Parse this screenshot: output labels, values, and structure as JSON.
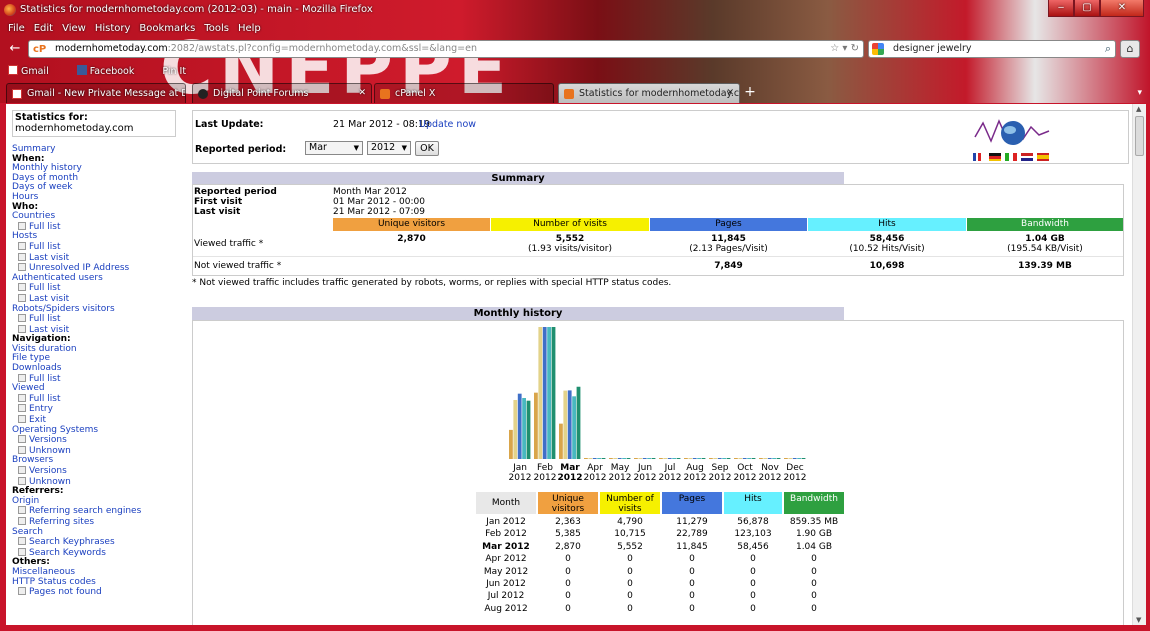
{
  "window": {
    "title": "Statistics for modernhometoday.com (2012-03) - main - Mozilla Firefox",
    "menu": [
      "File",
      "Edit",
      "View",
      "History",
      "Bookmarks",
      "Tools",
      "Help"
    ],
    "url_host": "modernhometoday.com",
    "url_path": ":2082/awstats.pl?config=modernhometoday.com&ssl=&lang=en",
    "url_badge": "cP",
    "search_value": "designer jewelry",
    "bookmarks": [
      "Gmail",
      "Facebook",
      "Pin It"
    ],
    "tabs": [
      {
        "label": "Gmail - New Private Message at Digit..."
      },
      {
        "label": "Digital Point Forums"
      },
      {
        "label": "cPanel X"
      },
      {
        "label": "Statistics for modernhometoday.com..."
      }
    ]
  },
  "sidebar": {
    "stats_for_label": "Statistics for:",
    "domain": "modernhometoday.com",
    "items": [
      {
        "t": "lk",
        "label": "Summary"
      },
      {
        "t": "hd",
        "label": "When:"
      },
      {
        "t": "lk",
        "label": "Monthly history"
      },
      {
        "t": "lk",
        "label": "Days of month"
      },
      {
        "t": "lk",
        "label": "Days of week"
      },
      {
        "t": "lk",
        "label": "Hours"
      },
      {
        "t": "hd",
        "label": "Who:"
      },
      {
        "t": "lk",
        "label": "Countries"
      },
      {
        "t": "sub",
        "label": "Full list"
      },
      {
        "t": "lk",
        "label": "Hosts"
      },
      {
        "t": "sub",
        "label": "Full list"
      },
      {
        "t": "sub",
        "label": "Last visit"
      },
      {
        "t": "sub",
        "label": "Unresolved IP Address"
      },
      {
        "t": "lk",
        "label": "Authenticated users"
      },
      {
        "t": "sub",
        "label": "Full list"
      },
      {
        "t": "sub",
        "label": "Last visit"
      },
      {
        "t": "lk",
        "label": "Robots/Spiders visitors"
      },
      {
        "t": "sub",
        "label": "Full list"
      },
      {
        "t": "sub",
        "label": "Last visit"
      },
      {
        "t": "hd",
        "label": "Navigation:"
      },
      {
        "t": "lk",
        "label": "Visits duration"
      },
      {
        "t": "lk",
        "label": "File type"
      },
      {
        "t": "lk",
        "label": "Downloads"
      },
      {
        "t": "sub",
        "label": "Full list"
      },
      {
        "t": "lk",
        "label": "Viewed"
      },
      {
        "t": "sub",
        "label": "Full list"
      },
      {
        "t": "sub",
        "label": "Entry"
      },
      {
        "t": "sub",
        "label": "Exit"
      },
      {
        "t": "lk",
        "label": "Operating Systems"
      },
      {
        "t": "sub",
        "label": "Versions"
      },
      {
        "t": "sub",
        "label": "Unknown"
      },
      {
        "t": "lk",
        "label": "Browsers"
      },
      {
        "t": "sub",
        "label": "Versions"
      },
      {
        "t": "sub",
        "label": "Unknown"
      },
      {
        "t": "hd",
        "label": "Referrers:"
      },
      {
        "t": "lk",
        "label": "Origin"
      },
      {
        "t": "sub",
        "label": "Referring search engines"
      },
      {
        "t": "sub",
        "label": "Referring sites"
      },
      {
        "t": "lk",
        "label": "Search"
      },
      {
        "t": "sub",
        "label": "Search Keyphrases"
      },
      {
        "t": "sub",
        "label": "Search Keywords"
      },
      {
        "t": "hd",
        "label": "Others:"
      },
      {
        "t": "lk",
        "label": "Miscellaneous"
      },
      {
        "t": "lk",
        "label": "HTTP Status codes"
      },
      {
        "t": "sub",
        "label": "Pages not found"
      }
    ]
  },
  "update": {
    "last_update_label": "Last Update:",
    "last_update_value": "21 Mar 2012 - 08:19",
    "update_now": "Update now",
    "period_label": "Reported period:",
    "month": "Mar",
    "year": "2012",
    "ok": "OK"
  },
  "summary": {
    "title": "Summary",
    "reported_period_label": "Reported period",
    "reported_period_value": "Month Mar 2012",
    "first_visit_label": "First visit",
    "first_visit_value": "01 Mar 2012 - 00:00",
    "last_visit_label": "Last visit",
    "last_visit_value": "21 Mar 2012 - 07:09",
    "headers": [
      "Unique visitors",
      "Number of visits",
      "Pages",
      "Hits",
      "Bandwidth"
    ],
    "viewed_label": "Viewed traffic *",
    "viewed": [
      {
        "v": "2,870",
        "s": ""
      },
      {
        "v": "5,552",
        "s": "(1.93 visits/visitor)"
      },
      {
        "v": "11,845",
        "s": "(2.13 Pages/Visit)"
      },
      {
        "v": "58,456",
        "s": "(10.52 Hits/Visit)"
      },
      {
        "v": "1.04 GB",
        "s": "(195.54 KB/Visit)"
      }
    ],
    "notviewed_label": "Not viewed traffic *",
    "notviewed": [
      "",
      "",
      "7,849",
      "10,698",
      "139.39 MB"
    ],
    "note": "* Not viewed traffic includes traffic generated by robots, worms, or replies with special HTTP status codes."
  },
  "history": {
    "title": "Monthly history",
    "headers": [
      "Month",
      "Unique visitors",
      "Number of visits",
      "Pages",
      "Hits",
      "Bandwidth"
    ],
    "rows": [
      [
        "Jan 2012",
        "2,363",
        "4,790",
        "11,279",
        "56,878",
        "859.35 MB"
      ],
      [
        "Feb 2012",
        "5,385",
        "10,715",
        "22,789",
        "123,103",
        "1.90 GB"
      ],
      [
        "Mar 2012",
        "2,870",
        "5,552",
        "11,845",
        "58,456",
        "1.04 GB"
      ],
      [
        "Apr 2012",
        "0",
        "0",
        "0",
        "0",
        "0"
      ],
      [
        "May 2012",
        "0",
        "0",
        "0",
        "0",
        "0"
      ],
      [
        "Jun 2012",
        "0",
        "0",
        "0",
        "0",
        "0"
      ],
      [
        "Jul 2012",
        "0",
        "0",
        "0",
        "0",
        "0"
      ],
      [
        "Aug 2012",
        "0",
        "0",
        "0",
        "0",
        "0"
      ]
    ]
  },
  "colors": {
    "visitors": "#f0a040",
    "visits": "#f6f000",
    "pages": "#4477dd",
    "hits": "#66f0ff",
    "bandwidth": "#2ea040",
    "visitors_bar": "#d9a54a",
    "visits_bar": "#e3d38a",
    "pages_bar": "#3f6fc8",
    "hits_bar": "#48b8c0",
    "bandwidth_bar": "#1f8f6f"
  },
  "chart_data": {
    "type": "bar",
    "categories": [
      "Jan 2012",
      "Feb 2012",
      "Mar 2012",
      "Apr 2012",
      "May 2012",
      "Jun 2012",
      "Jul 2012",
      "Aug 2012",
      "Sep 2012",
      "Oct 2012",
      "Nov 2012",
      "Dec 2012"
    ],
    "tick_month": [
      "Jan",
      "Feb",
      "Mar",
      "Apr",
      "May",
      "Jun",
      "Jul",
      "Aug",
      "Sep",
      "Oct",
      "Nov",
      "Dec"
    ],
    "tick_year": [
      "2012",
      "2012",
      "2012",
      "2012",
      "2012",
      "2012",
      "2012",
      "2012",
      "2012",
      "2012",
      "2012",
      "2012"
    ],
    "highlight": 2,
    "series": [
      {
        "key": "visitors",
        "values": [
          2363,
          5385,
          2870,
          0,
          0,
          0,
          0,
          0,
          0,
          0,
          0,
          0
        ]
      },
      {
        "key": "visits",
        "values": [
          4790,
          10715,
          5552,
          0,
          0,
          0,
          0,
          0,
          0,
          0,
          0,
          0
        ]
      },
      {
        "key": "pages",
        "values": [
          11279,
          22789,
          11845,
          0,
          0,
          0,
          0,
          0,
          0,
          0,
          0,
          0
        ]
      },
      {
        "key": "hits",
        "values": [
          56878,
          123103,
          58456,
          0,
          0,
          0,
          0,
          0,
          0,
          0,
          0,
          0
        ]
      },
      {
        "key": "bandwidth",
        "values": [
          859.35,
          1945.6,
          1064.96,
          0,
          0,
          0,
          0,
          0,
          0,
          0,
          0,
          0
        ]
      }
    ]
  }
}
